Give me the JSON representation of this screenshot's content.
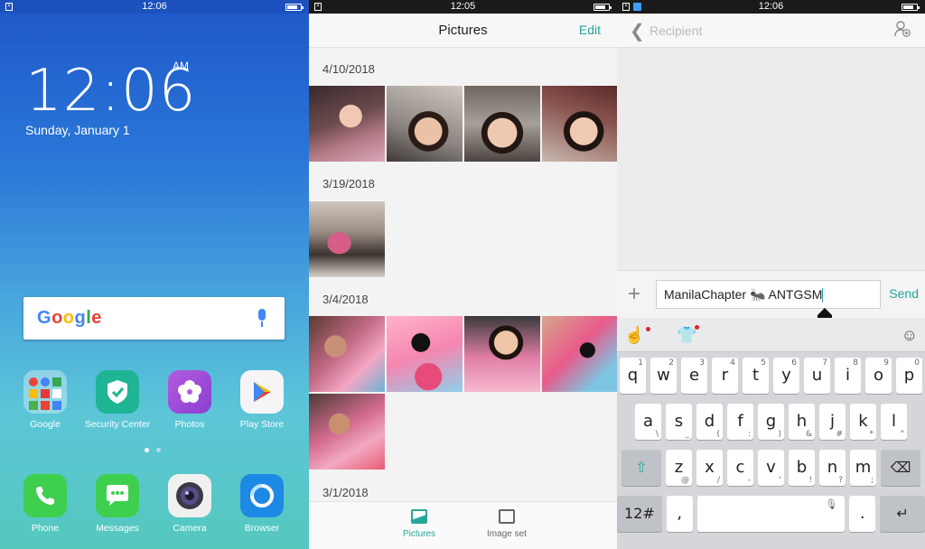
{
  "home": {
    "status_time": "12:06",
    "clock": "12:06",
    "ampm": "AM",
    "date": "Sunday, January 1",
    "search_logo": "Google",
    "apps_row1": [
      {
        "label": "Google",
        "icon": "google-folder-icon"
      },
      {
        "label": "Security Center",
        "icon": "shield-icon"
      },
      {
        "label": "Photos",
        "icon": "flower-icon"
      },
      {
        "label": "Play Store",
        "icon": "play-store-icon"
      }
    ],
    "apps_row2": [
      {
        "label": "Phone",
        "icon": "phone-icon"
      },
      {
        "label": "Messages",
        "icon": "chat-bubble-icon"
      },
      {
        "label": "Camera",
        "icon": "camera-icon"
      },
      {
        "label": "Browser",
        "icon": "browser-icon"
      }
    ]
  },
  "gallery": {
    "status_time": "12:05",
    "title": "Pictures",
    "edit": "Edit",
    "sections": [
      {
        "date": "4/10/2018",
        "count": 4
      },
      {
        "date": "3/19/2018",
        "count": 1
      },
      {
        "date": "3/4/2018",
        "count": 5
      },
      {
        "date": "3/1/2018",
        "count": 0
      }
    ],
    "tabs": [
      {
        "label": "Pictures",
        "active": true
      },
      {
        "label": "Image set",
        "active": false
      }
    ],
    "accent": "#26a69a"
  },
  "compose": {
    "status_time": "12:06",
    "recipient_placeholder": "Recipient",
    "message_text": "ManilaChapter 🐜 ANTGSM",
    "send": "Send",
    "keyboard": {
      "row1": [
        [
          "q",
          "1"
        ],
        [
          "w",
          "2"
        ],
        [
          "e",
          "3"
        ],
        [
          "r",
          "4"
        ],
        [
          "t",
          "5"
        ],
        [
          "y",
          "6"
        ],
        [
          "u",
          "7"
        ],
        [
          "i",
          "8"
        ],
        [
          "o",
          "9"
        ],
        [
          "p",
          "0"
        ]
      ],
      "row2": [
        [
          "a",
          "\\"
        ],
        [
          "s",
          "_"
        ],
        [
          "d",
          "("
        ],
        [
          "f",
          ":"
        ],
        [
          "g",
          ")"
        ],
        [
          "h",
          "&"
        ],
        [
          "j",
          "#"
        ],
        [
          "k",
          "*"
        ],
        [
          "l",
          "\""
        ]
      ],
      "row3": [
        [
          "z",
          "@"
        ],
        [
          "x",
          "/"
        ],
        [
          "c",
          "-"
        ],
        [
          "v",
          "'"
        ],
        [
          "b",
          "!"
        ],
        [
          "n",
          "?"
        ],
        [
          "m",
          ";"
        ]
      ],
      "num_key": "12#",
      "comma_key": ",",
      "period_key": "."
    }
  }
}
